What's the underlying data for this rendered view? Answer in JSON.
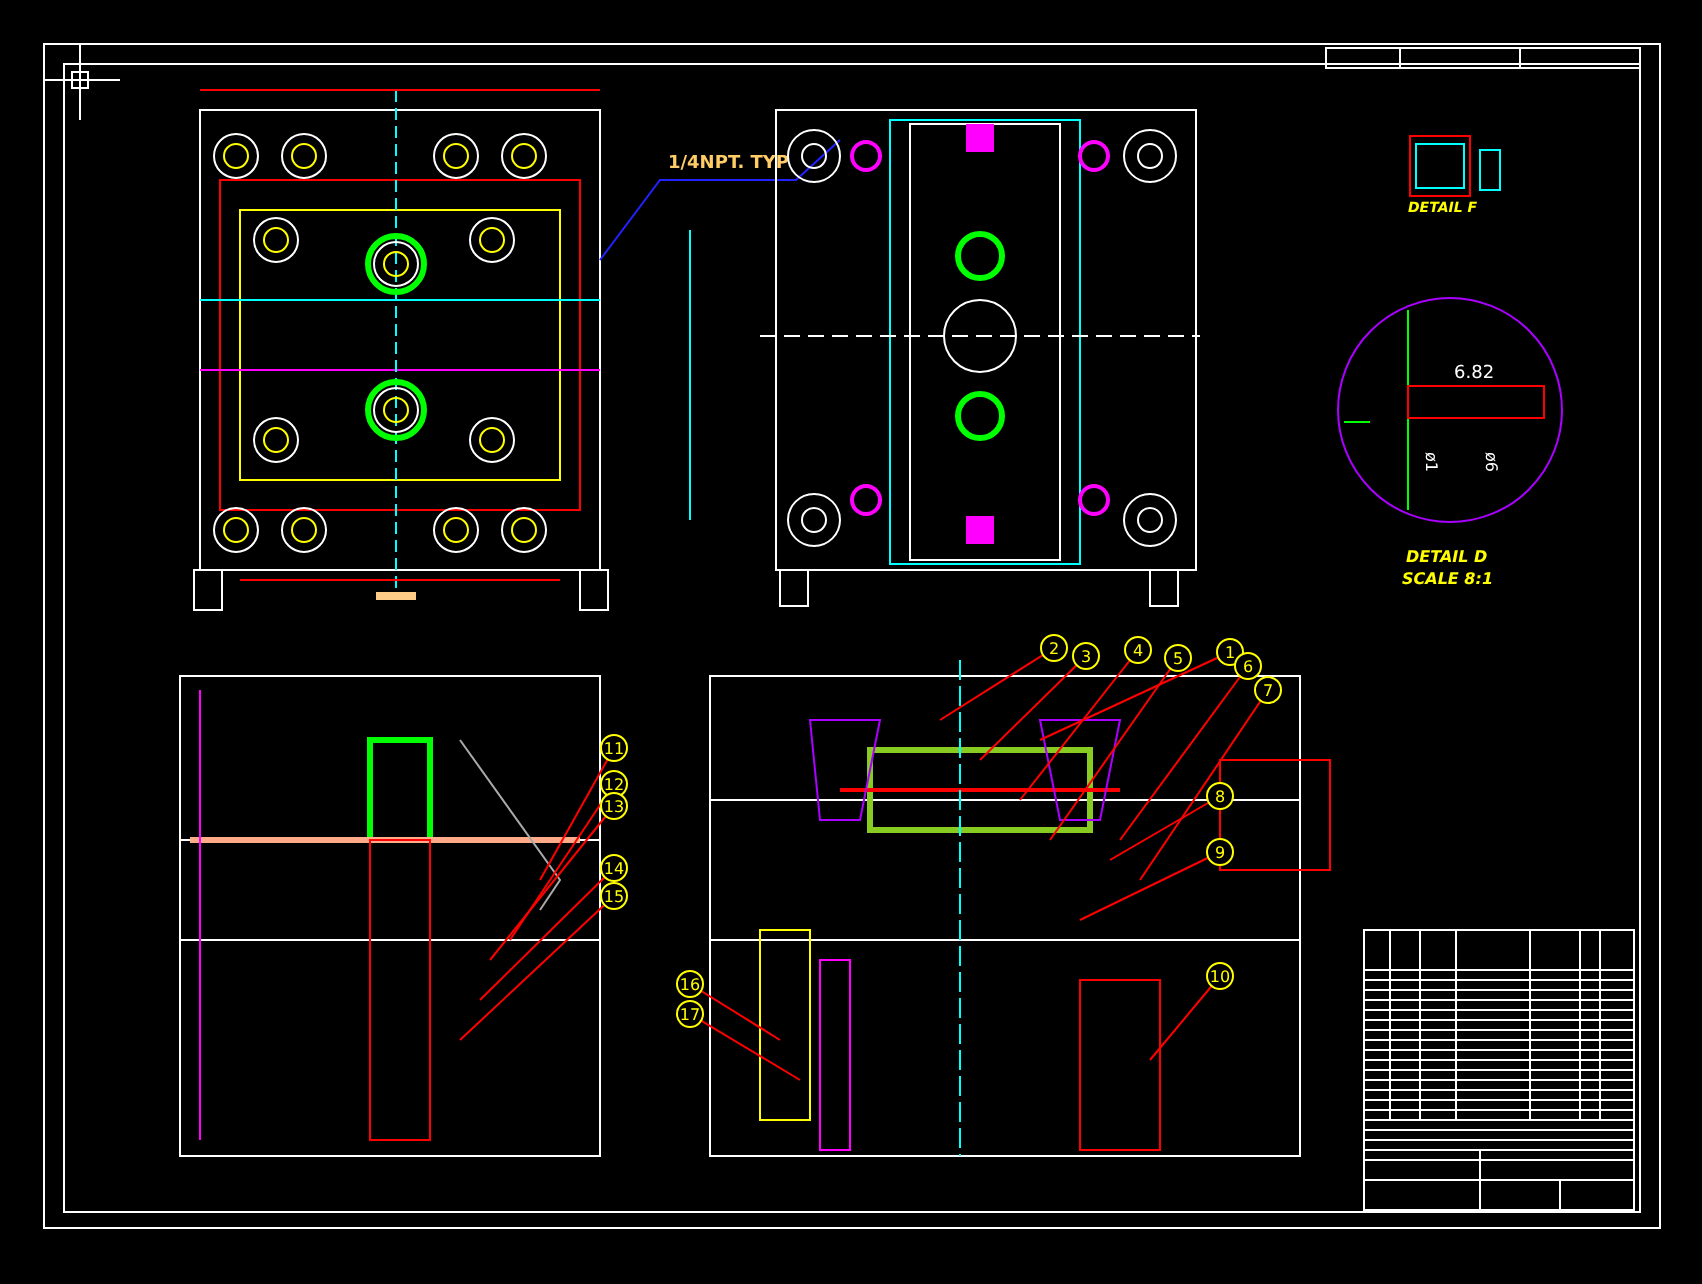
{
  "drawing": {
    "leader_label": "1/4NPT. TYP",
    "detail_f": {
      "title": "DETAIL F"
    },
    "detail_d": {
      "dimension": "6.82",
      "diameter_labels": [
        "ø1",
        "ø6"
      ],
      "title": "DETAIL D",
      "scale": "SCALE 8:1"
    },
    "balloons": [
      {
        "number": "11"
      },
      {
        "number": "12"
      },
      {
        "number": "13"
      },
      {
        "number": "14"
      },
      {
        "number": "15"
      },
      {
        "number": "16"
      },
      {
        "number": "17"
      },
      {
        "number": "2"
      },
      {
        "number": "3"
      },
      {
        "number": "4"
      },
      {
        "number": "5"
      },
      {
        "number": "1"
      },
      {
        "number": "6"
      },
      {
        "number": "7"
      },
      {
        "number": "8"
      },
      {
        "number": "9"
      },
      {
        "number": "10"
      }
    ]
  }
}
